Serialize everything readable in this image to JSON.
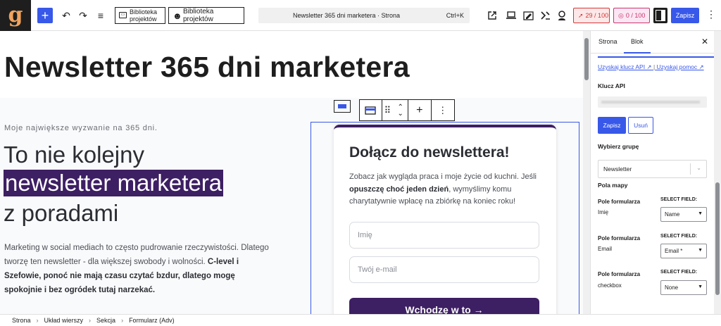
{
  "topbar": {
    "logo_letter": "g",
    "add_label": "+",
    "undo_icon": "↶",
    "redo_icon": "↷",
    "list_icon": "≡",
    "library_btn_1": "Biblioteka projektów",
    "library_btn_2": "Biblioteka projektów",
    "command_title": "Newsletter 365 dni marketera · Strona",
    "command_shortcut": "Ctrl+K",
    "score_1": "29 / 100",
    "score_2": "0 / 100",
    "save_label": "Zapisz",
    "more_icon": "⋮",
    "accent_color": "#3858e9"
  },
  "content": {
    "page_title": "Newsletter 365 dni marketera",
    "tagline": "Moje największe wyzwanie na 365 dni.",
    "headline_line1": "To nie kolejny",
    "headline_line2": "newsletter marketera",
    "headline_line3": "z poradami",
    "para_1": "Marketing w social mediach to często pudrowanie rzeczywistości. Dlatego tworzę ten newsletter - dla większej swobody i wolności. ",
    "para_bold_1": "C-level i Szefowie, ponoć nie mają czasu czytać bzdur, dlatego mogę spokojnie i bez ogródek tutaj narzekać.",
    "brand_color": "#3d1f63"
  },
  "block_toolbar": {
    "drag_icon": "⠿",
    "move_up_icon": "⌃",
    "move_down_icon": "⌄",
    "add_icon": "+",
    "options_icon": "⋮"
  },
  "form_card": {
    "title": "Dołącz do newslettera!",
    "desc_1": "Zobacz jak wygląda praca i moje życie od kuchni. Jeśli ",
    "desc_bold": "opuszczę choć jeden dzień",
    "desc_2": ", wymyślimy komu charytatywnie wpłacę na zbiórkę na koniec roku!",
    "name_placeholder": "Imię",
    "email_placeholder": "Twój e-mail",
    "submit_label": "Wchodzę w to →"
  },
  "breadcrumb": [
    "Strona",
    "Układ wierszy",
    "Sekcja",
    "Formularz (Adv)"
  ],
  "sidebar": {
    "tab_1": "Strona",
    "tab_2": "Blok",
    "close_icon": "✕",
    "link_api": "Uzyskaj klucz API ↗",
    "link_help": "Uzyskaj pomoc ↗",
    "api_label": "Klucz API",
    "save_label": "Zapisz",
    "delete_label": "Usuń",
    "group_label": "Wybierz grupę",
    "group_value": "Newsletter",
    "map_label": "Pola mapy",
    "rows": [
      {
        "title": "Pole formularza",
        "name": "Imię",
        "select_label": "SELECT FIELD:",
        "value": "Name"
      },
      {
        "title": "Pole formularza",
        "name": "Email",
        "select_label": "SELECT FIELD:",
        "value": "Email *"
      },
      {
        "title": "Pole formularza",
        "name": "checkbox",
        "select_label": "SELECT FIELD:",
        "value": "None"
      }
    ]
  }
}
